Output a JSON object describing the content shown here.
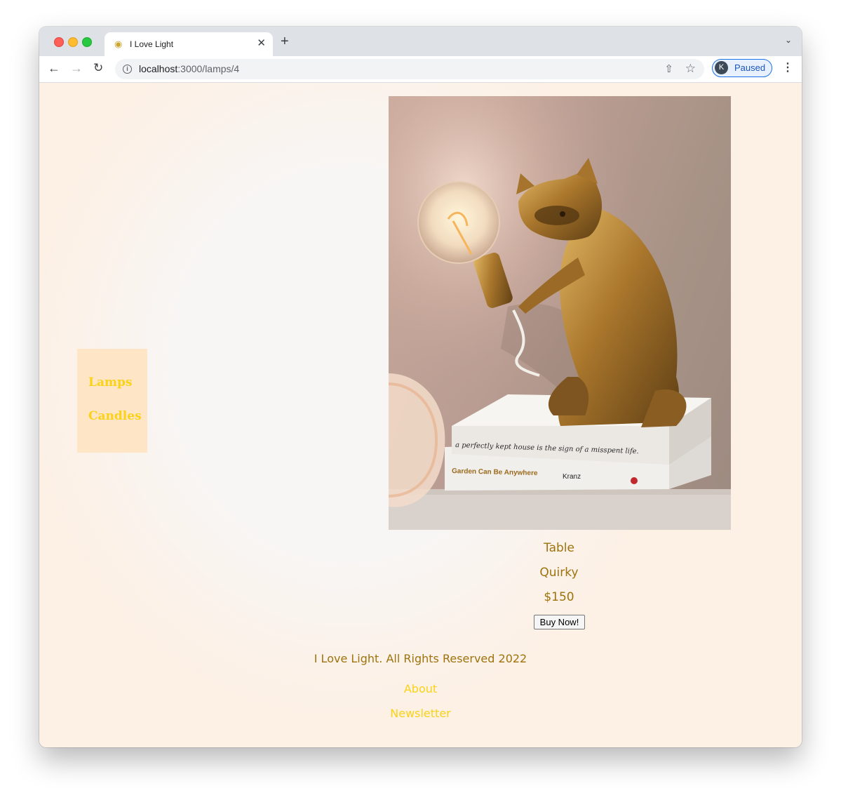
{
  "browser": {
    "tab_title": "I Love Light",
    "tab_favicon": "lightbulb-icon",
    "url_host": "localhost",
    "url_path": ":3000/lamps/4",
    "profile_initial": "K",
    "profile_status": "Paused"
  },
  "sidebar": {
    "items": [
      {
        "label": "Lamps"
      },
      {
        "label": "Candles"
      }
    ]
  },
  "product": {
    "type": "Table",
    "style": "Quirky",
    "price": "$150",
    "buy_label": "Buy Now!",
    "image_book_text_1": "a perfectly kept house is the sign of a misspent life.",
    "image_book_text_2": "Garden Can Be Anywhere",
    "image_book_author": "Kranz"
  },
  "footer": {
    "copyright": "I Love Light. All Rights Reserved 2022",
    "links": [
      {
        "label": "About"
      },
      {
        "label": "Newsletter"
      }
    ]
  },
  "colors": {
    "page_bg": "#fdf0e4",
    "accent_yellow": "#fbd215",
    "text_gold": "#9e730d",
    "sidebar_bg": "#fde5c6"
  }
}
